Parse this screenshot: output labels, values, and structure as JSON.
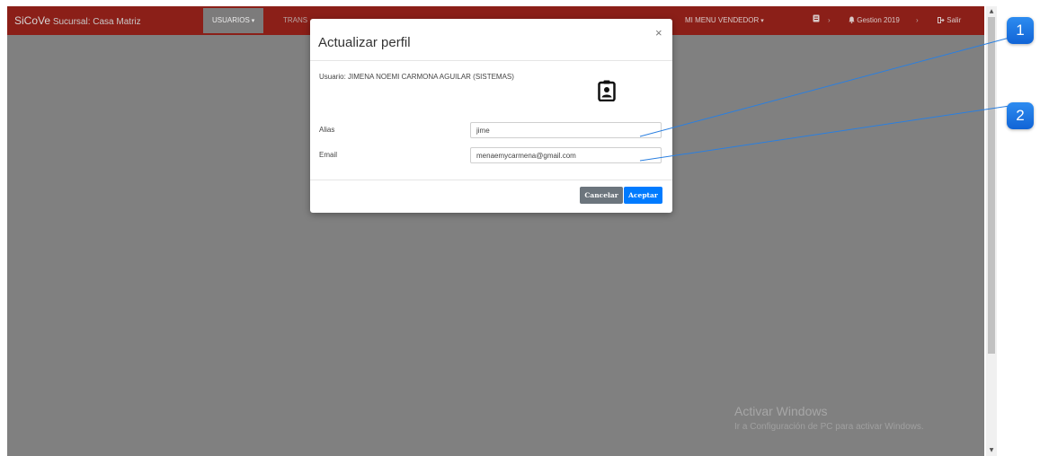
{
  "navbar": {
    "brand_name": "SiCoVe",
    "brand_branch": "Sucursal: Casa Matriz",
    "items": [
      {
        "label": "USUARIOS",
        "caret": "▾"
      },
      {
        "label": "TRANS"
      },
      {
        "label": "MI MENU VENDEDOR",
        "caret": "▾"
      }
    ],
    "right": {
      "doc_icon": "document-icon",
      "sep1": "›",
      "bell_icon": "bell-icon",
      "gestion": "Gestion 2019",
      "sep2": "›",
      "logout_icon": "sign-out-icon",
      "logout": "Salir"
    },
    "colors": {
      "bar": "#8b1f18",
      "active": "#7c7b7b"
    }
  },
  "modal": {
    "title": "Actualizar perfil",
    "close": "×",
    "user_line": "Usuario: JIMENA NOEMI CARMONA AGUILAR (SISTEMAS)",
    "profile_icon": "id-badge-icon",
    "fields": {
      "alias_label": "Alias",
      "alias_value": "jime",
      "email_label": "Email",
      "email_value": "menaemycarmena@gmail.com"
    },
    "buttons": {
      "cancel": "Cancelar",
      "ok": "Aceptar"
    },
    "colors": {
      "cancel": "#6c757d",
      "ok": "#007bff"
    }
  },
  "watermark": {
    "title": "Activar Windows",
    "subtitle": "Ir a Configuración de PC para activar Windows."
  },
  "callouts": [
    {
      "number": "1"
    },
    {
      "number": "2"
    }
  ]
}
